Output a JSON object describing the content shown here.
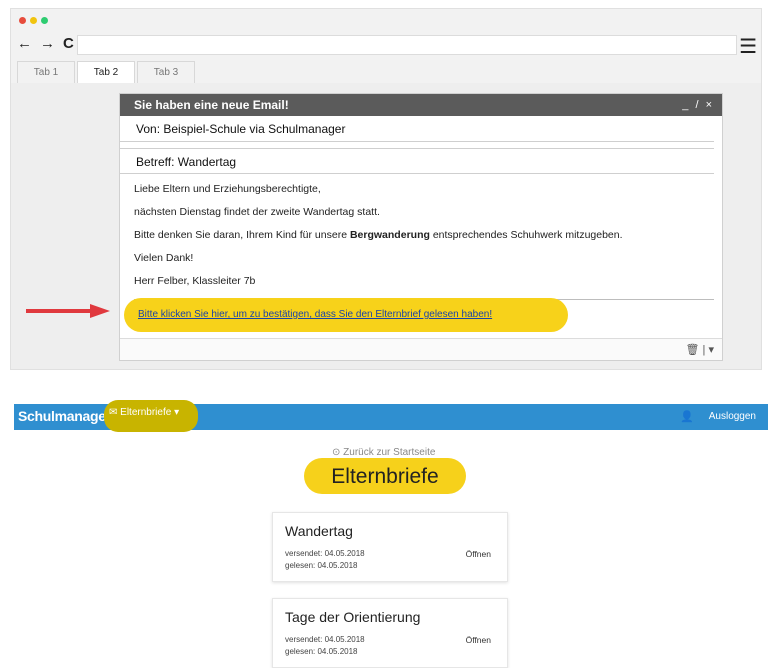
{
  "browser": {
    "dot_colors": [
      "#e74c3c",
      "#f1c40f",
      "#2ecc71"
    ],
    "nav": {
      "back": "←",
      "forward": "→",
      "reload": "C"
    },
    "menu_icon": "☰",
    "tabs": [
      "Tab 1",
      "Tab 2",
      "Tab 3"
    ],
    "active_tab": 1
  },
  "email": {
    "header": "Sie haben eine neue Email!",
    "window_controls": "_ / ×",
    "from": "Von: Beispiel-Schule via Schulmanager",
    "subject": "Betreff: Wandertag",
    "greeting": "Liebe Eltern und Erziehungsberechtigte,",
    "line1": "nächsten Dienstag findet der zweite Wandertag statt.",
    "line2_before": "Bitte denken Sie daran, Ihrem Kind für unsere ",
    "line2_bold": "Bergwanderung",
    "line2_after": " entsprechendes Schuhwerk mitzugeben.",
    "thanks": "Vielen Dank!",
    "signature": "Herr Felber, Klassleiter 7b",
    "confirm_link": "Bitte klicken Sie hier, um zu bestätigen, dass Sie den Elternbrief gelesen haben!",
    "footer_icons": "🗑 | ▾",
    "arrow_color": "#e0393e",
    "highlight_color": "#f7d21a"
  },
  "app": {
    "brand": "Schulmanager",
    "menu": "✉ Elternbriefe ▾",
    "user_icon": "👤",
    "logout": "Ausloggen",
    "back": "⊙ Zurück zur Startseite",
    "title": "Elternbriefe",
    "bar_color": "#2f8fd0",
    "letters": [
      {
        "title": "Wandertag",
        "sent": "versendet: 04.05.2018",
        "read": "gelesen: 04.05.2018",
        "action": "Öffnen"
      },
      {
        "title": "Tage der Orientierung",
        "sent": "versendet: 04.05.2018",
        "read": "gelesen: 04.05.2018",
        "action": "Öffnen"
      }
    ]
  }
}
